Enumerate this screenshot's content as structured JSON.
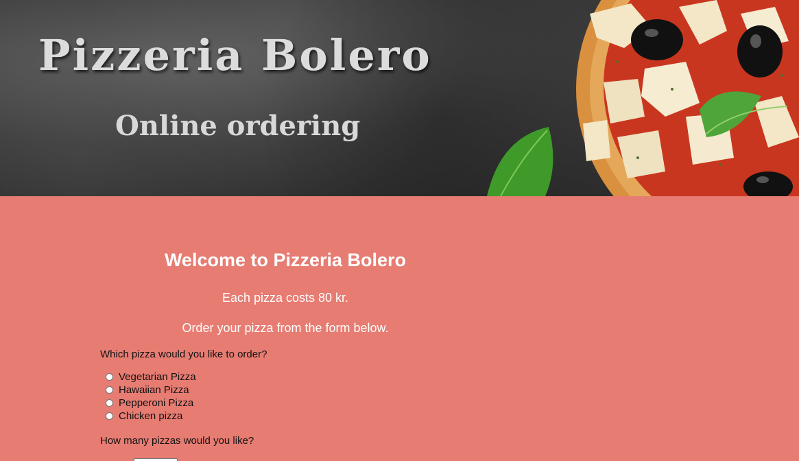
{
  "header": {
    "title": "Pizzeria Bolero",
    "subtitle": "Online ordering"
  },
  "main": {
    "welcome": "Welcome to Pizzeria Bolero",
    "price_text": "Each pizza costs 80 kr.",
    "order_text": "Order your pizza from the form below.",
    "pizza_question": "Which pizza would you like to order?",
    "pizza_options": [
      {
        "label": "Vegetarian Pizza"
      },
      {
        "label": "Hawaiian Pizza"
      },
      {
        "label": "Pepperoni Pizza"
      },
      {
        "label": "Chicken pizza"
      }
    ],
    "quantity_question": "How many pizzas would you like?",
    "quantity_value": ""
  },
  "colors": {
    "main_background": "#e77c72",
    "header_background": "#3a3a3a"
  }
}
